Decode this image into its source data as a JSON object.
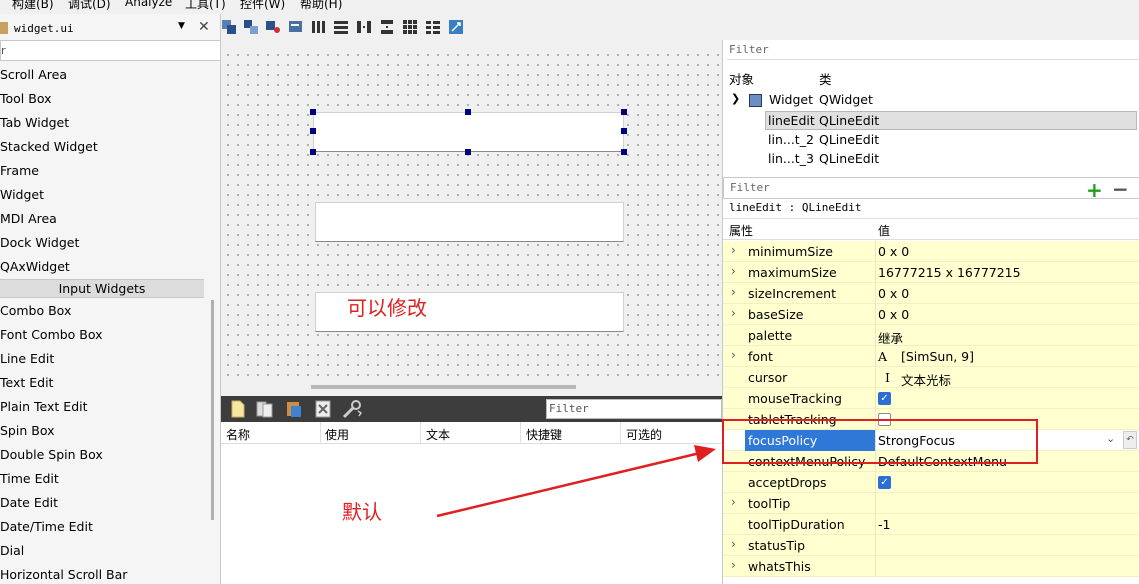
{
  "menubar": {
    "items": [
      "构建(B)",
      "调试(D)",
      "Analyze",
      "工具(T)",
      "控件(W)",
      "帮助(H)"
    ]
  },
  "widget_box": {
    "title": "widget.ui",
    "filter_text": "r",
    "items": [
      "Scroll Area",
      "Tool Box",
      "Tab Widget",
      "Stacked Widget",
      "Frame",
      "Widget",
      "MDI Area",
      "Dock Widget",
      "QAxWidget"
    ],
    "category": "Input Widgets",
    "input_items": [
      "Combo Box",
      "Font Combo Box",
      "Line Edit",
      "Text Edit",
      "Plain Text Edit",
      "Spin Box",
      "Double Spin Box",
      "Time Edit",
      "Date Edit",
      "Date/Time Edit",
      "Dial",
      "Horizontal Scroll Bar"
    ]
  },
  "canvas": {
    "annotation": "可以修改"
  },
  "action_editor": {
    "filter_placeholder": "Filter",
    "columns": [
      "名称",
      "使用",
      "文本",
      "快捷键",
      "可选的"
    ],
    "annotation": "默认"
  },
  "object_inspector": {
    "filter_placeholder": "Filter",
    "col_object": "对象",
    "col_class": "类",
    "rows": [
      {
        "object": "Widget",
        "class": "QWidget"
      },
      {
        "object": "lineEdit",
        "class": "QLineEdit"
      },
      {
        "object": "lin...t_2",
        "class": "QLineEdit"
      },
      {
        "object": "lin...t_3",
        "class": "QLineEdit"
      }
    ]
  },
  "property_editor": {
    "filter_placeholder": "Filter",
    "object_label": "lineEdit : QLineEdit",
    "col_property": "属性",
    "col_value": "值",
    "rows": [
      {
        "name": "minimumSize",
        "value": "0 x 0"
      },
      {
        "name": "maximumSize",
        "value": "16777215 x 16777215"
      },
      {
        "name": "sizeIncrement",
        "value": "0 x 0"
      },
      {
        "name": "baseSize",
        "value": "0 x 0"
      },
      {
        "name": "palette",
        "value": "继承"
      },
      {
        "name": "font",
        "value": "[SimSun, 9]"
      },
      {
        "name": "cursor",
        "value": "文本光标"
      },
      {
        "name": "mouseTracking",
        "value": ""
      },
      {
        "name": "tabletTracking",
        "value": ""
      },
      {
        "name": "focusPolicy",
        "value": "StrongFocus"
      },
      {
        "name": "contextMenuPolicy",
        "value": "DefaultContextMenu"
      },
      {
        "name": "acceptDrops",
        "value": ""
      },
      {
        "name": "toolTip",
        "value": ""
      },
      {
        "name": "toolTipDuration",
        "value": "-1"
      },
      {
        "name": "statusTip",
        "value": ""
      },
      {
        "name": "whatsThis",
        "value": ""
      }
    ],
    "font_glyph": "A",
    "cursor_glyph": "I"
  },
  "colors": {
    "annotation_red": "#e02020",
    "selection_blue": "#3078d8",
    "property_bg": "#ffffd0",
    "checkbox_blue": "#2b6fd6",
    "add_green": "#20a020"
  }
}
